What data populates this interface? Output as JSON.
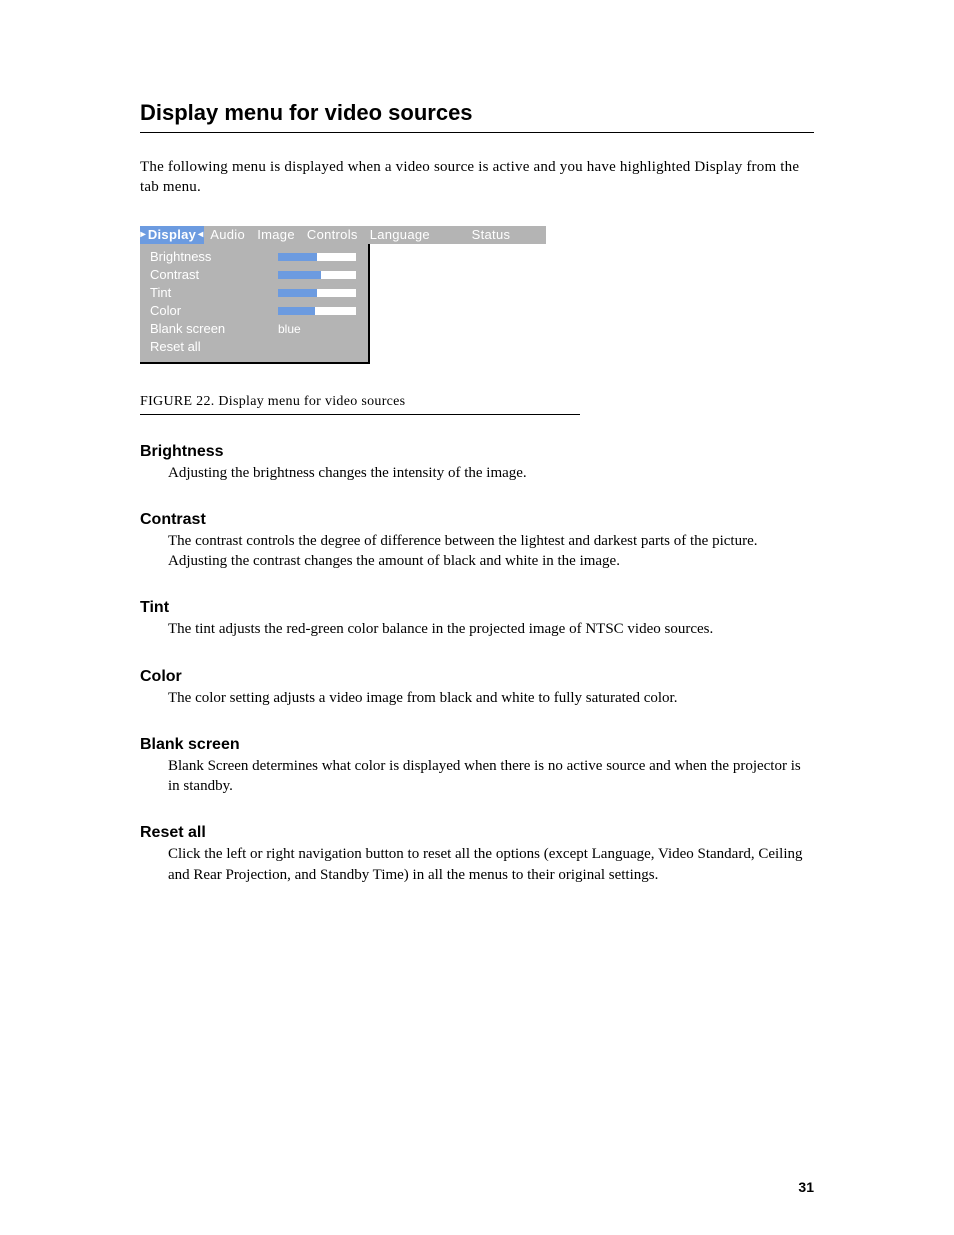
{
  "section_title": "Display menu for video sources",
  "intro": "The following menu is displayed when a video source is active and you have highlighted Display from the tab menu.",
  "osd": {
    "tabs": [
      "Display",
      "Audio",
      "Image",
      "Controls",
      "Language",
      "Status"
    ],
    "active_tab_index": 0,
    "items": [
      {
        "label": "Brightness",
        "type": "slider",
        "value_pct": 50
      },
      {
        "label": "Contrast",
        "type": "slider",
        "value_pct": 55
      },
      {
        "label": "Tint",
        "type": "slider",
        "value_pct": 50
      },
      {
        "label": "Color",
        "type": "slider",
        "value_pct": 47
      },
      {
        "label": "Blank screen",
        "type": "text",
        "value": "blue"
      },
      {
        "label": "Reset all",
        "type": "none"
      }
    ]
  },
  "figure_caption": "FIGURE 22. Display menu for video sources",
  "terms": [
    {
      "term": "Brightness",
      "desc": "Adjusting the brightness changes the intensity of the image."
    },
    {
      "term": "Contrast",
      "desc": "The contrast controls the degree of difference between the lightest and darkest parts of the picture. Adjusting the contrast changes the amount of black and white in the image."
    },
    {
      "term": "Tint",
      "desc": "The tint adjusts the red-green color balance in the projected image of NTSC video sources."
    },
    {
      "term": "Color",
      "desc": "The color setting adjusts a video image from black and white to fully saturated color."
    },
    {
      "term": "Blank screen",
      "desc": "Blank Screen determines what color is displayed when there is no active source and when the projector is in standby."
    },
    {
      "term": "Reset all",
      "desc": "Click the left or right navigation button to reset all the options (except Language, Video Standard, Ceiling and Rear Projection, and Standby Time) in all the menus to their original settings."
    }
  ],
  "page_number": "31"
}
